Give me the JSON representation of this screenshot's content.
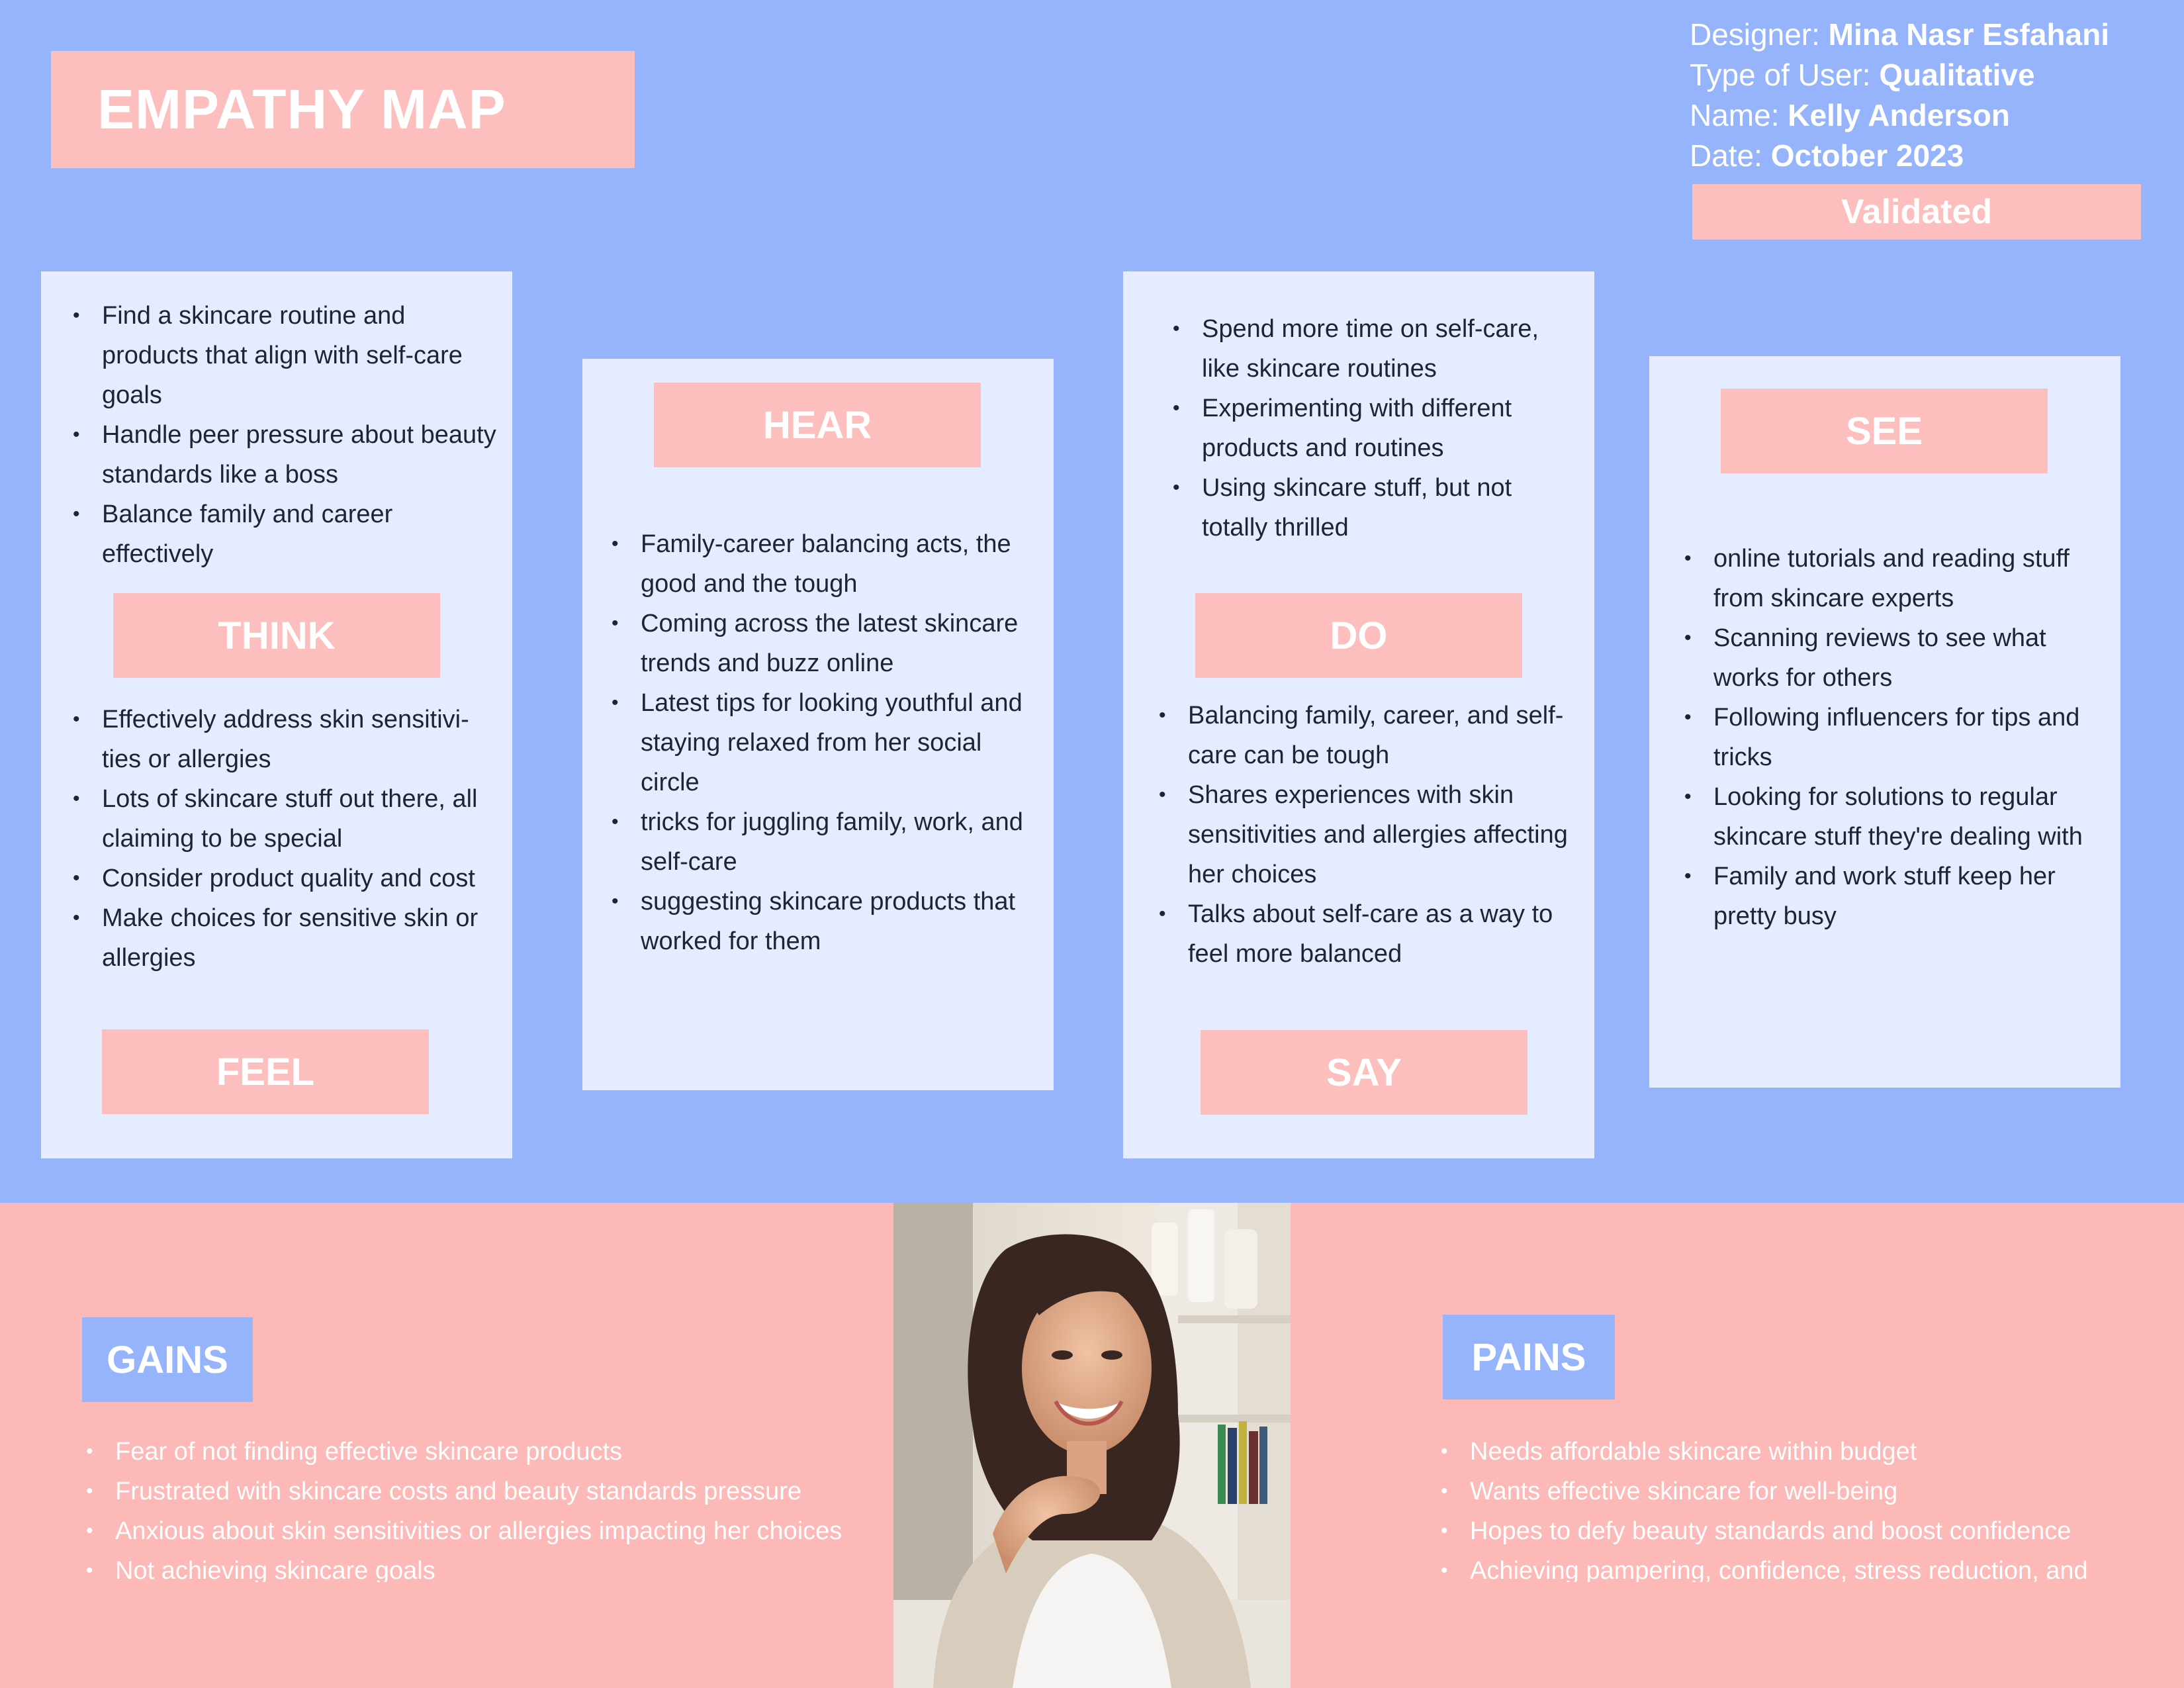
{
  "header": {
    "title": "EMPATHY MAP",
    "designer_label": "Designer:",
    "designer_value": " Mina Nasr Esfahani",
    "user_type_label": "Type of User:",
    "user_type_value": " Qualitative",
    "name_label": "Name:",
    "name_value": " Kelly Anderson",
    "date_label": "Date:",
    "date_value": " October 2023",
    "status_badge": "Validated"
  },
  "colors": {
    "background_blue": "#96b4fc",
    "panel": "#e6ecff",
    "pink": "#fdbfbd",
    "bottom_pink": "#fdb9b8"
  },
  "think_feel": {
    "think_label": "THINK",
    "feel_label": "FEEL",
    "think_items": [
      "Find a skincare routine and products that align with self-care goals",
      "Handle peer pressure about beauty standards like a boss",
      "Balance family and career effectively"
    ],
    "feel_items": [
      "Effectively address skin sensitivi-ties or allergies",
      "Lots of skincare stuff out there, all claiming to be special",
      "Consider product quality and cost",
      "Make choices for sensitive skin or allergies"
    ]
  },
  "hear": {
    "label": "HEAR",
    "items": [
      "Family-career balancing acts, the good and the tough",
      "Coming across the latest skincare trends and buzz online",
      "Latest tips for looking youthful and staying relaxed from her social circle",
      "tricks for juggling family, work, and self-care",
      "suggesting skincare products that worked for them"
    ]
  },
  "do_say": {
    "do_label": "DO",
    "say_label": "SAY",
    "do_items": [
      "Spend more time on self-care, like skincare routines",
      "Experimenting with different products and routines",
      "Using skincare stuff, but not totally thrilled"
    ],
    "say_items": [
      "Balancing family, career, and self-care can be tough",
      "Shares experiences with skin sensitivities and allergies affecting her choices",
      "Talks about self-care as a way to feel more balanced"
    ]
  },
  "see": {
    "label": "SEE",
    "items": [
      "online tutorials and reading stuff from skincare experts",
      "Scanning reviews to see what works for others",
      "Following influencers for tips and tricks",
      "Looking for solutions to regular skincare stuff they're dealing with",
      "Family and work stuff keep her pretty busy"
    ]
  },
  "gains": {
    "label": "GAINS",
    "items": [
      "Fear of not finding effective skincare products",
      "Frustrated with skincare costs and beauty standards pressure",
      "Anxious about skin sensitivities or allergies impacting her choices",
      "Not achieving skincare goals"
    ]
  },
  "pains": {
    "label": "PAINS",
    "items": [
      "Needs affordable skincare within budget",
      "Wants effective skincare for well-being",
      "Hopes to defy beauty standards and boost confidence",
      "Achieving pampering, confidence, stress reduction, and"
    ]
  }
}
